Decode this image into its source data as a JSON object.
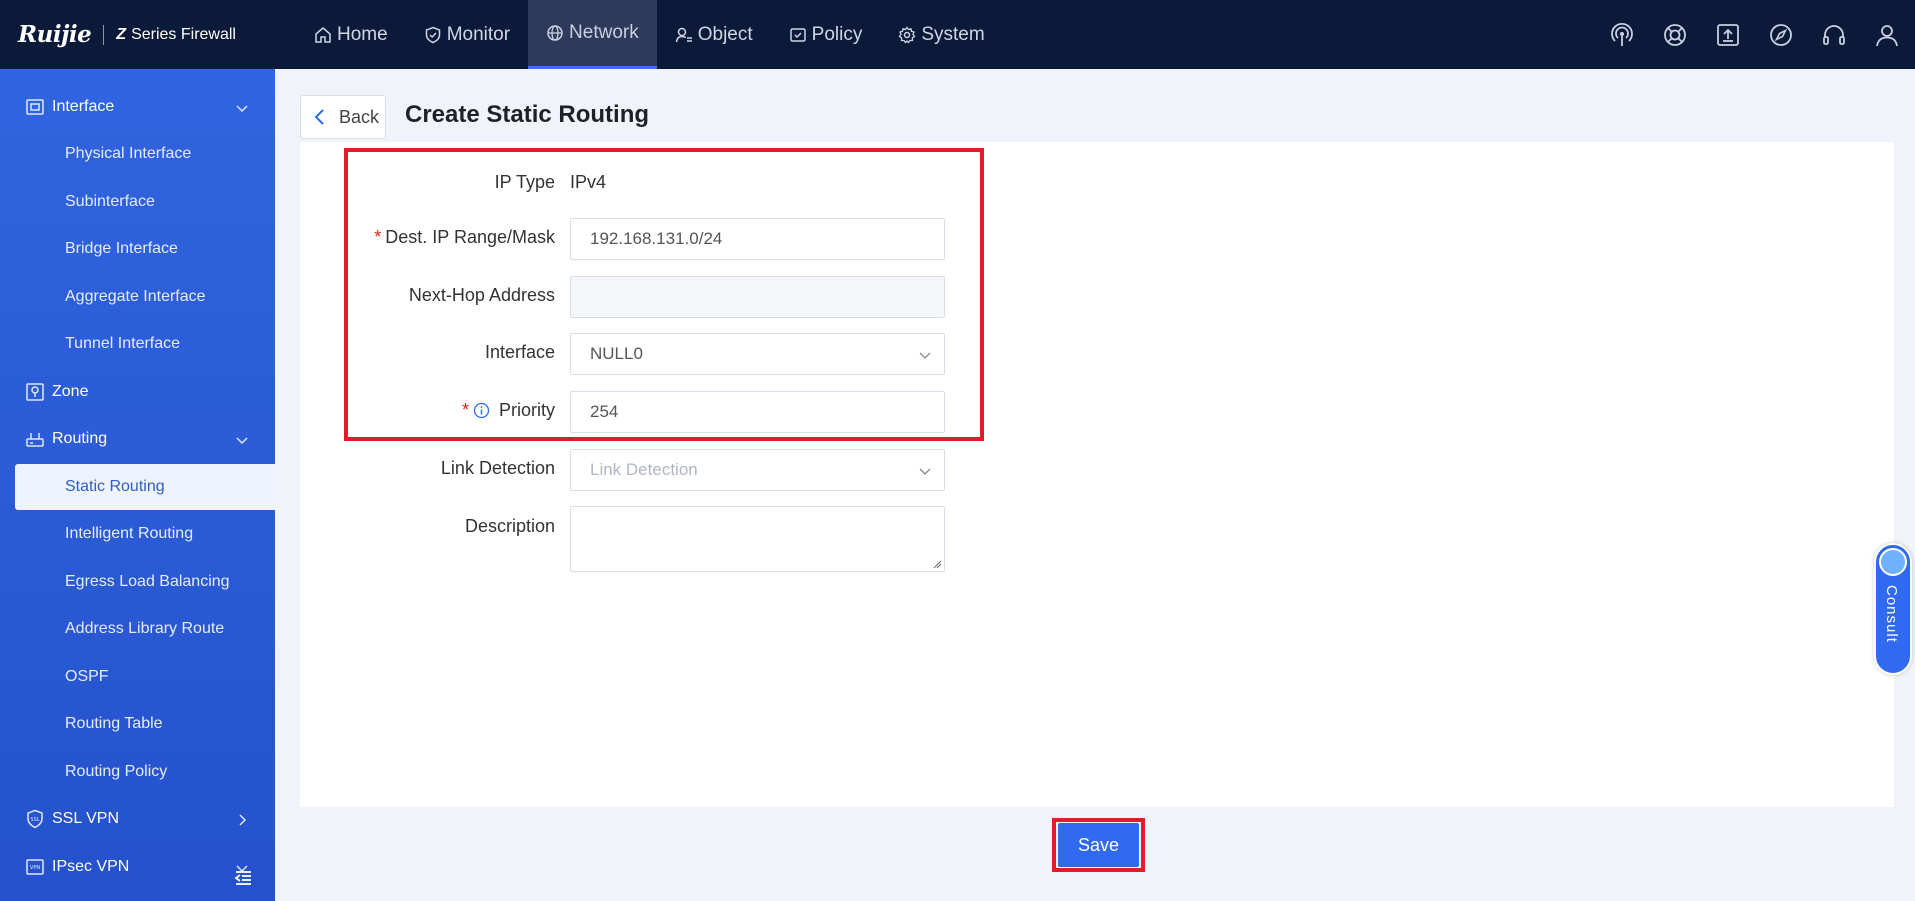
{
  "brand": {
    "logo": "Ruijie",
    "product": "Series Firewall",
    "series_letter": "Z"
  },
  "nav": [
    {
      "label": "Home",
      "icon": "home-icon"
    },
    {
      "label": "Monitor",
      "icon": "shield-icon"
    },
    {
      "label": "Network",
      "icon": "globe-icon",
      "active": true
    },
    {
      "label": "Object",
      "icon": "user-object-icon"
    },
    {
      "label": "Policy",
      "icon": "policy-icon"
    },
    {
      "label": "System",
      "icon": "gear-icon"
    }
  ],
  "top_icons": [
    "signal-icon",
    "lifebuoy-icon",
    "upload-icon",
    "compass-icon",
    "headset-icon",
    "user-icon"
  ],
  "sidebar": {
    "interface_group": "Interface",
    "interface_items": [
      "Physical Interface",
      "Subinterface",
      "Bridge Interface",
      "Aggregate Interface",
      "Tunnel Interface"
    ],
    "zone": "Zone",
    "routing_group": "Routing",
    "routing_items": [
      "Static Routing",
      "Intelligent Routing",
      "Egress Load Balancing",
      "Address Library Route",
      "OSPF",
      "Routing Table",
      "Routing Policy"
    ],
    "active_item": "Static Routing",
    "ssl_vpn": "SSL VPN",
    "ipsec_vpn": "IPsec VPN"
  },
  "page": {
    "back_label": "Back",
    "title": "Create Static Routing"
  },
  "form": {
    "ip_type_label": "IP Type",
    "ip_type_value": "IPv4",
    "dest_label": "Dest. IP Range/Mask",
    "dest_value": "192.168.131.0/24",
    "next_hop_label": "Next-Hop Address",
    "next_hop_value": "",
    "interface_label": "Interface",
    "interface_value": "NULL0",
    "priority_label": "Priority",
    "priority_value": "254",
    "link_detection_label": "Link Detection",
    "link_detection_placeholder": "Link Detection",
    "description_label": "Description",
    "required_mark": "*"
  },
  "actions": {
    "save_label": "Save"
  },
  "consult": {
    "label": "Consult"
  },
  "colors": {
    "accent": "#2f6af0",
    "highlight": "#e21d2a",
    "topbar": "#0c1a3a",
    "sidebar": "#2d5ddb"
  }
}
